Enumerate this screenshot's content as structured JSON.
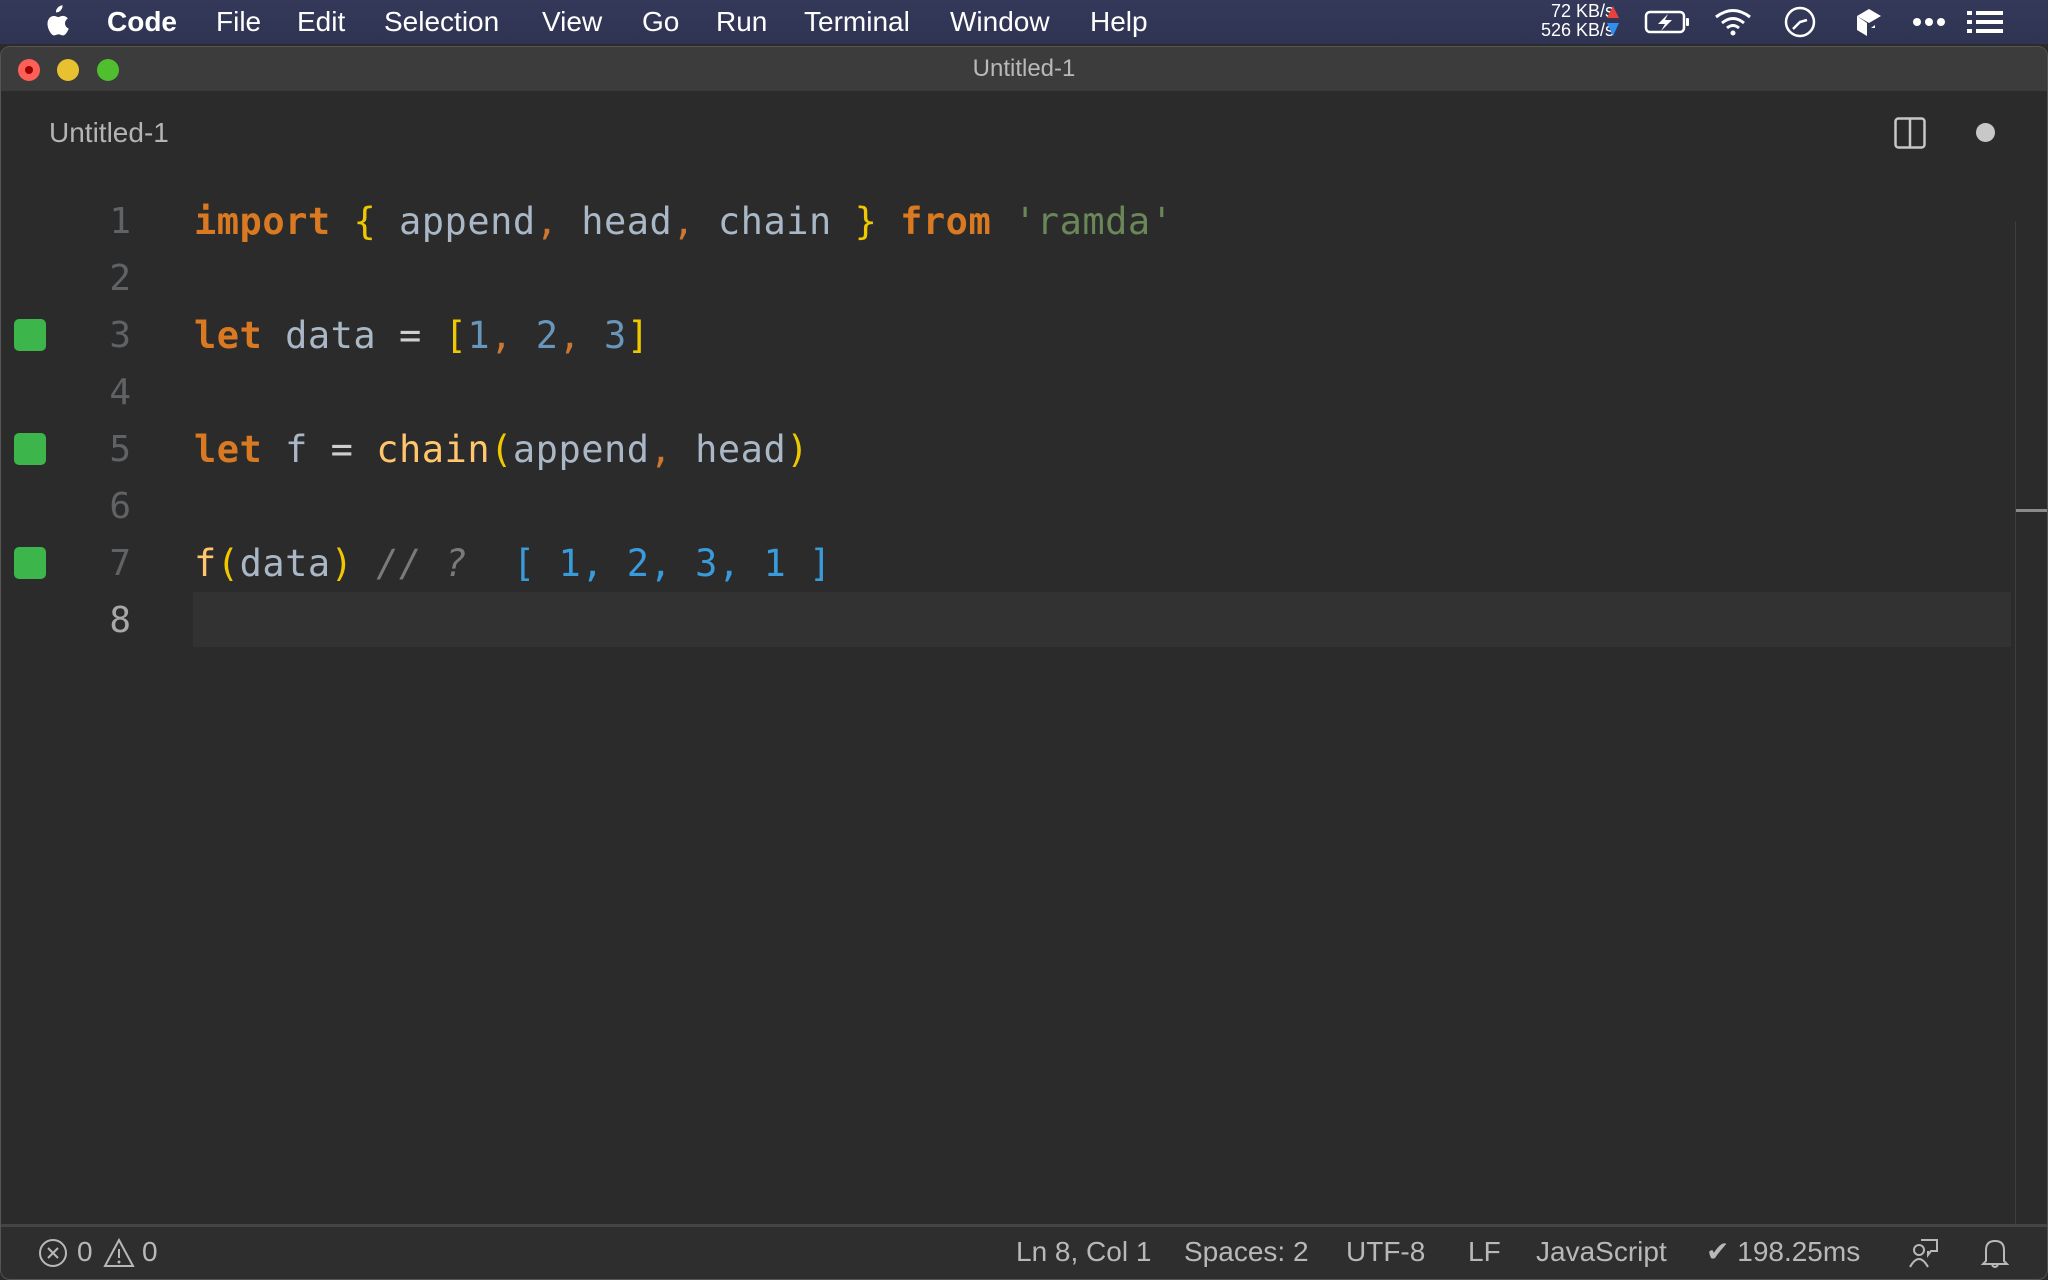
{
  "menubar": {
    "app_name": "Code",
    "items": [
      "File",
      "Edit",
      "Selection",
      "View",
      "Go",
      "Run",
      "Terminal",
      "Window",
      "Help"
    ],
    "network": {
      "upload": "72 KB/s",
      "download": "526 KB/s"
    },
    "tray_icons": [
      "battery-charging-icon",
      "wifi-icon",
      "clock-icon",
      "app-icon",
      "more-icon",
      "list-icon"
    ]
  },
  "window": {
    "title": "Untitled-1"
  },
  "tab": {
    "label": "Untitled-1",
    "unsaved": true
  },
  "editor": {
    "current_line": 8,
    "lines": [
      {
        "number": "1",
        "marker": false
      },
      {
        "number": "2",
        "marker": false
      },
      {
        "number": "3",
        "marker": true
      },
      {
        "number": "4",
        "marker": false
      },
      {
        "number": "5",
        "marker": true
      },
      {
        "number": "6",
        "marker": false
      },
      {
        "number": "7",
        "marker": true
      },
      {
        "number": "8",
        "marker": false
      }
    ],
    "tokens": {
      "l1": {
        "import": "import",
        "ob": "{",
        "a": "append",
        "c1": ",",
        "h": "head",
        "c2": ",",
        "ch": "chain",
        "cb": "}",
        "from": "from",
        "mod": "'ramda'"
      },
      "l3": {
        "let": "let",
        "name": "data",
        "eq": "=",
        "lb": "[",
        "n1": "1",
        "c1": ",",
        "n2": "2",
        "c2": ",",
        "n3": "3",
        "rb": "]"
      },
      "l5": {
        "let": "let",
        "name": "f",
        "eq": "=",
        "fn": "chain",
        "lp": "(",
        "a": "append",
        "c": ",",
        "h": "head",
        "rp": ")"
      },
      "l7": {
        "fn": "f",
        "lp": "(",
        "arg": "data",
        "rp": ")",
        "comment": "// ?",
        "result": "[ 1, 2, 3, 1 ]"
      }
    },
    "marker_color": "#3cb64a"
  },
  "statusbar": {
    "errors": "0",
    "warnings": "0",
    "position": "Ln 8, Col 1",
    "indent": "Spaces: 2",
    "encoding": "UTF-8",
    "eol": "LF",
    "language": "JavaScript",
    "timing": "✔ 198.25ms"
  }
}
